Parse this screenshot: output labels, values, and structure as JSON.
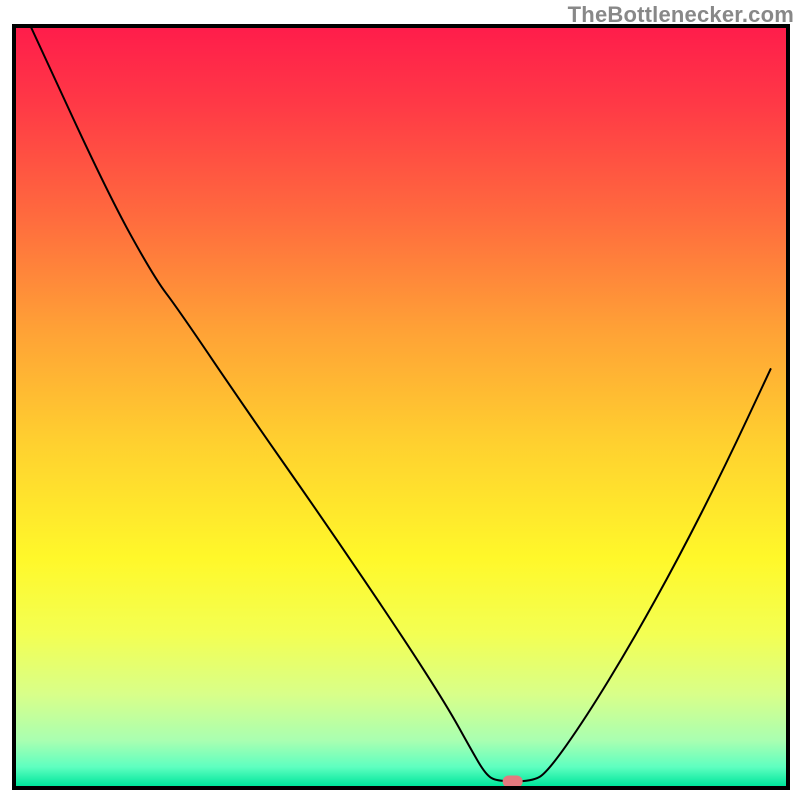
{
  "watermark": "TheBottlenecker.com",
  "chart_data": {
    "type": "line",
    "title": "",
    "xlabel": "",
    "ylabel": "",
    "xlim": [
      0,
      100
    ],
    "ylim": [
      0,
      100
    ],
    "background": {
      "type": "vertical-gradient",
      "stops": [
        {
          "offset": 0.0,
          "color": "#ff1d4b"
        },
        {
          "offset": 0.1,
          "color": "#ff3946"
        },
        {
          "offset": 0.25,
          "color": "#ff6b3e"
        },
        {
          "offset": 0.4,
          "color": "#ffa236"
        },
        {
          "offset": 0.55,
          "color": "#ffd12f"
        },
        {
          "offset": 0.7,
          "color": "#fff82a"
        },
        {
          "offset": 0.8,
          "color": "#f3ff53"
        },
        {
          "offset": 0.88,
          "color": "#d8ff8a"
        },
        {
          "offset": 0.94,
          "color": "#a9ffb1"
        },
        {
          "offset": 0.975,
          "color": "#5effc0"
        },
        {
          "offset": 1.0,
          "color": "#00e69b"
        }
      ]
    },
    "series": [
      {
        "name": "bottleneck-curve",
        "color": "#000000",
        "stroke_width": 2,
        "points": [
          {
            "x": 2.0,
            "y": 100.0
          },
          {
            "x": 12.0,
            "y": 78.0
          },
          {
            "x": 18.0,
            "y": 67.0
          },
          {
            "x": 21.0,
            "y": 63.0
          },
          {
            "x": 30.0,
            "y": 49.5
          },
          {
            "x": 40.0,
            "y": 35.0
          },
          {
            "x": 50.0,
            "y": 20.0
          },
          {
            "x": 56.0,
            "y": 10.5
          },
          {
            "x": 59.0,
            "y": 5.0
          },
          {
            "x": 61.0,
            "y": 1.5
          },
          {
            "x": 62.5,
            "y": 0.6
          },
          {
            "x": 67.0,
            "y": 0.6
          },
          {
            "x": 69.0,
            "y": 1.8
          },
          {
            "x": 74.0,
            "y": 9.0
          },
          {
            "x": 80.0,
            "y": 19.0
          },
          {
            "x": 86.0,
            "y": 30.0
          },
          {
            "x": 92.0,
            "y": 42.0
          },
          {
            "x": 98.0,
            "y": 55.0
          }
        ]
      }
    ],
    "marker": {
      "name": "optimal-point",
      "x": 64.5,
      "y": 0.6,
      "color": "#e37a7f",
      "rx": 10,
      "ry": 6
    },
    "frame": {
      "color": "#000000",
      "width": 4
    }
  }
}
